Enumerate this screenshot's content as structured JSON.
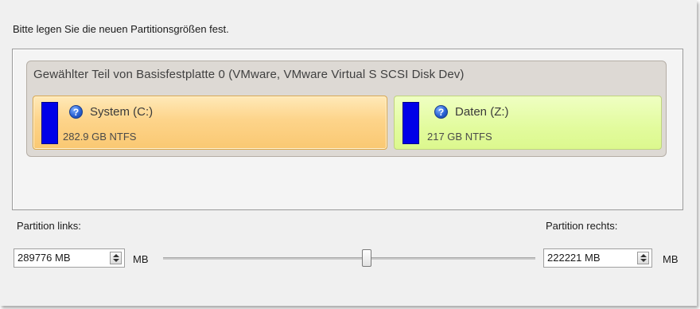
{
  "dialog": {
    "instruction": "Bitte legen Sie die neuen Partitionsgrößen fest."
  },
  "disk": {
    "title": "Gewählter Teil von Basisfestplatte 0 (VMware, VMware Virtual S SCSI Disk Dev)",
    "partitions": [
      {
        "name": "System (C:)",
        "info": "282.9 GB NTFS",
        "icon": "help-icon",
        "color": "#fdd48a",
        "selected": true
      },
      {
        "name": "Daten (Z:)",
        "info": "217 GB NTFS",
        "icon": "help-icon",
        "color": "#e2fb9d",
        "selected": false
      }
    ],
    "usage_color": "#0000e8"
  },
  "resize": {
    "left_label": "Partition links:",
    "right_label": "Partition rechts:",
    "left_value": "289776 MB",
    "right_value": "222221 MB",
    "unit": "MB",
    "slider_fraction": 0.54
  }
}
